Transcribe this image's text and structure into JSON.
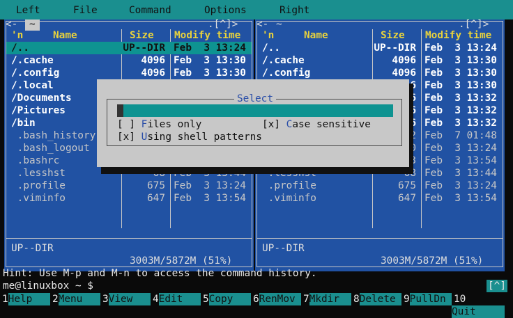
{
  "menubar": [
    "Left",
    "File",
    "Command",
    "Options",
    "Right"
  ],
  "left_panel": {
    "path": "~",
    "sort": "'n",
    "col_name": "Name",
    "col_size": "Size",
    "col_time": "Modify time",
    "top_right": ".[^]>",
    "rows": [
      {
        "name": "/..",
        "size": "UP--DIR",
        "time": "Feb  3 13:24",
        "kind": "dir",
        "selected": true
      },
      {
        "name": "/.cache",
        "size": "4096",
        "time": "Feb  3 13:30",
        "kind": "dir"
      },
      {
        "name": "/.config",
        "size": "4096",
        "time": "Feb  3 13:30",
        "kind": "dir"
      },
      {
        "name": "/.local",
        "size": "",
        "time": "",
        "kind": "dir"
      },
      {
        "name": "/Documents",
        "size": "",
        "time": "",
        "kind": "dir"
      },
      {
        "name": "/Pictures",
        "size": "",
        "time": "",
        "kind": "dir"
      },
      {
        "name": "/bin",
        "size": "",
        "time": "",
        "kind": "dir"
      },
      {
        "name": " .bash_history",
        "size": "",
        "time": "",
        "kind": "file"
      },
      {
        "name": " .bash_logout",
        "size": "",
        "time": "",
        "kind": "file"
      },
      {
        "name": " .bashrc",
        "size": "",
        "time": "",
        "kind": "file"
      },
      {
        "name": " .lesshst",
        "size": "68",
        "time": "Feb  3 13:44",
        "kind": "file"
      },
      {
        "name": " .profile",
        "size": "675",
        "time": "Feb  3 13:24",
        "kind": "file"
      },
      {
        "name": " .viminfo",
        "size": "647",
        "time": "Feb  3 13:54",
        "kind": "file"
      }
    ],
    "status": "UP--DIR",
    "disk": "3003M/5872M (51%)"
  },
  "right_panel": {
    "path": "~",
    "sort": "'n",
    "col_name": "Name",
    "col_size": "Size",
    "col_time": "Modify time",
    "top_right": ".[^]>",
    "rows": [
      {
        "name": "/..",
        "size": "UP--DIR",
        "time": "Feb  3 13:24",
        "kind": "dir"
      },
      {
        "name": "/.cache",
        "size": "4096",
        "time": "Feb  3 13:30",
        "kind": "dir"
      },
      {
        "name": "/.config",
        "size": "4096",
        "time": "Feb  3 13:30",
        "kind": "dir"
      },
      {
        "name": "",
        "size": "6",
        "time": "Feb  3 13:30",
        "kind": "dir"
      },
      {
        "name": "",
        "size": "6",
        "time": "Feb  3 13:32",
        "kind": "dir"
      },
      {
        "name": "",
        "size": "6",
        "time": "Feb  3 13:32",
        "kind": "dir"
      },
      {
        "name": "",
        "size": "6",
        "time": "Feb  3 13:32",
        "kind": "dir"
      },
      {
        "name": "",
        "size": "2",
        "time": "Feb  7 01:48",
        "kind": "file"
      },
      {
        "name": "",
        "size": "0",
        "time": "Feb  3 13:24",
        "kind": "file"
      },
      {
        "name": "",
        "size": "3",
        "time": "Feb  3 13:54",
        "kind": "file"
      },
      {
        "name": " .lesshst",
        "size": "68",
        "time": "Feb  3 13:44",
        "kind": "file"
      },
      {
        "name": " .profile",
        "size": "675",
        "time": "Feb  3 13:24",
        "kind": "file"
      },
      {
        "name": " .viminfo",
        "size": "647",
        "time": "Feb  3 13:54",
        "kind": "file"
      }
    ],
    "status": "UP--DIR",
    "disk": "3003M/5872M (51%)"
  },
  "dialog": {
    "title": "Select",
    "input_value": "",
    "opt_files_only_box": "[ ]",
    "opt_files_only_hot": "F",
    "opt_files_only_rest": "iles only",
    "opt_case_box": "[x]",
    "opt_case_hot": "C",
    "opt_case_rest": "ase sensitive",
    "opt_shell_box": "[x]",
    "opt_shell_hot": "U",
    "opt_shell_rest": "sing shell patterns"
  },
  "hint": "Hint: Use M-p and M-n to access the command history.",
  "prompt": "me@linuxbox ~ $",
  "scroll_button": "[^]",
  "fkeys": [
    {
      "num": "1",
      "label": "Help"
    },
    {
      "num": "2",
      "label": "Menu"
    },
    {
      "num": "3",
      "label": "View"
    },
    {
      "num": "4",
      "label": "Edit"
    },
    {
      "num": "5",
      "label": "Copy"
    },
    {
      "num": "6",
      "label": "RenMov"
    },
    {
      "num": "7",
      "label": "Mkdir"
    },
    {
      "num": "8",
      "label": "Delete"
    },
    {
      "num": "9",
      "label": "PullDn"
    },
    {
      "num": "10",
      "label": "Quit"
    }
  ]
}
